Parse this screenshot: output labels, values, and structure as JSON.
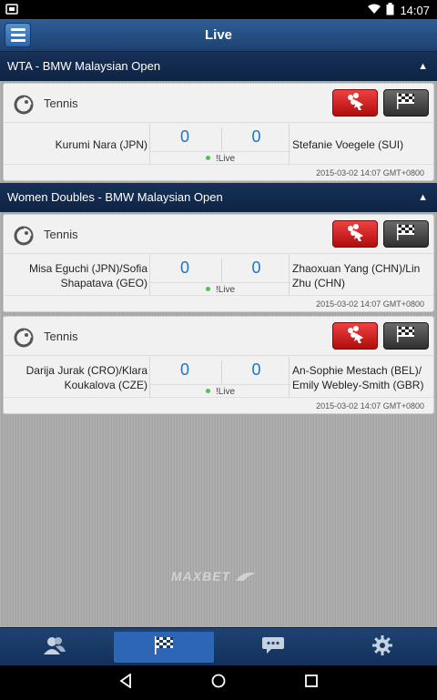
{
  "status_bar": {
    "time": "14:07"
  },
  "header": {
    "title": "Live"
  },
  "sections": [
    {
      "title": "WTA - BMW Malaysian Open",
      "matches": [
        {
          "sport": "Tennis",
          "home": "Kurumi Nara (JPN)",
          "away": "Stefanie Voegele (SUI)",
          "home_score": "0",
          "away_score": "0",
          "status": "!Live",
          "timestamp": "2015-03-02 14:07 GMT+0800"
        }
      ]
    },
    {
      "title": "Women Doubles - BMW Malaysian Open",
      "matches": [
        {
          "sport": "Tennis",
          "home": "Misa Eguchi (JPN)/Sofia Shapatava (GEO)",
          "away": "Zhaoxuan Yang (CHN)/Lin Zhu (CHN)",
          "home_score": "0",
          "away_score": "0",
          "status": "!Live",
          "timestamp": "2015-03-02 14:07 GMT+0800"
        },
        {
          "sport": "Tennis",
          "home": "Darija Jurak (CRO)/Klara Koukalova (CZE)",
          "away": "An-Sophie Mestach (BEL)/ Emily Webley-Smith (GBR)",
          "home_score": "0",
          "away_score": "0",
          "status": "!Live",
          "timestamp": "2015-03-02 14:07 GMT+0800"
        }
      ]
    }
  ],
  "brand": {
    "logo_text": "MAXBET"
  },
  "tabs": [
    {
      "icon": "users-icon"
    },
    {
      "icon": "checkered-flag-icon",
      "active": true
    },
    {
      "icon": "chat-bubble-icon"
    },
    {
      "icon": "gear-icon"
    }
  ],
  "colors": {
    "header_blue": "#1c416f",
    "section_navy": "#0e2444",
    "score_blue": "#1e74c8",
    "live_green": "#4fc15a",
    "parlay_red": "#d61a1a"
  }
}
